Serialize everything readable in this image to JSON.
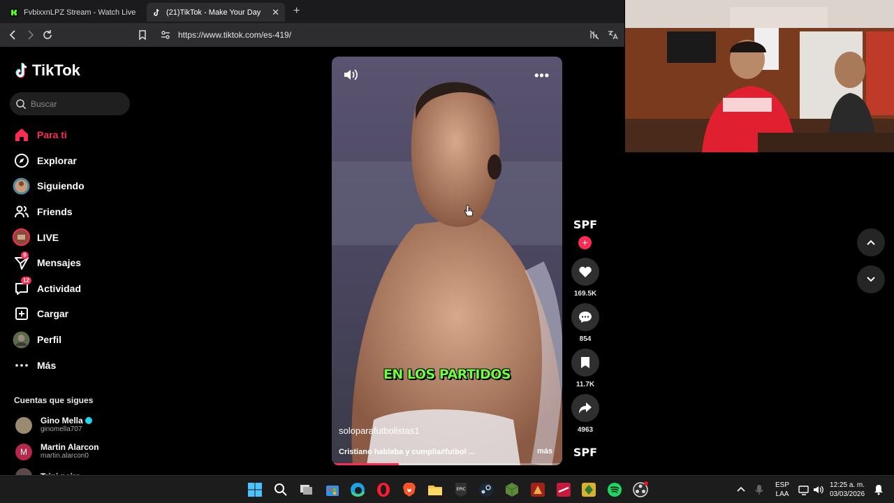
{
  "browser": {
    "tabs": [
      {
        "title": "FvbixxnLPZ Stream - Watch Live on K",
        "icon": "kick-icon"
      },
      {
        "title": "(21)TikTok - Make Your Day",
        "icon": "tiktok-icon"
      }
    ],
    "close_glyph": "✕",
    "new_tab_glyph": "+",
    "url": "https://www.tiktok.com/es-419/"
  },
  "sidebar": {
    "logo": "TikTok",
    "search_placeholder": "Buscar",
    "items": [
      {
        "label": "Para ti",
        "icon": "home-icon",
        "active": true
      },
      {
        "label": "Explorar",
        "icon": "compass-icon"
      },
      {
        "label": "Siguiendo",
        "icon": "avatar-icon"
      },
      {
        "label": "Friends",
        "icon": "friends-icon"
      },
      {
        "label": "LIVE",
        "icon": "live-icon"
      },
      {
        "label": "Mensajes",
        "icon": "send-icon",
        "badge": "9"
      },
      {
        "label": "Actividad",
        "icon": "inbox-icon",
        "badge": "12"
      },
      {
        "label": "Cargar",
        "icon": "upload-icon"
      },
      {
        "label": "Perfil",
        "icon": "profile-avatar"
      },
      {
        "label": "Más",
        "icon": "more-icon"
      }
    ],
    "following_header": "Cuentas que sigues",
    "following": [
      {
        "name": "Gino Mella",
        "handle": "ginomella707",
        "verified": true
      },
      {
        "name": "Martin Alarcon",
        "handle": "martin.alarcon0",
        "initial": "M"
      },
      {
        "name": "Trini neira",
        "handle": ""
      }
    ]
  },
  "video": {
    "subtitle": "EN LOS PARTIDOS",
    "author": "soloparafutbolistas1",
    "description": "Cristiano hablaba y cumplia#futbol ...",
    "more_label": "más",
    "progress": 0.29,
    "more_dots": "•••"
  },
  "actions": {
    "profile_text": "SPF",
    "plus": "+",
    "likes": "169.5K",
    "comments": "854",
    "saves": "11.7K",
    "shares": "4963"
  },
  "taskbar": {
    "lang_line1": "ESP",
    "lang_line2": "LAA",
    "time": "12:25 a. m.",
    "date": "03/03/2026"
  },
  "colors": {
    "accent": "#fe2c55",
    "subtitle_green": "#6dff3d"
  }
}
